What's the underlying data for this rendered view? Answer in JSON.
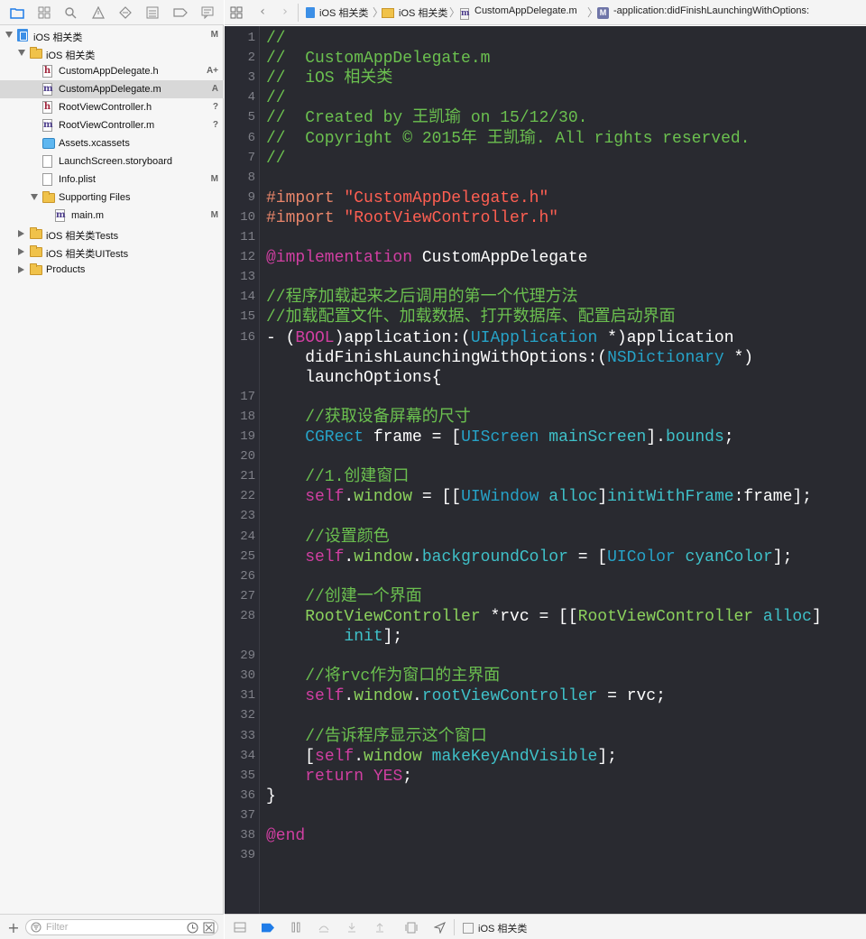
{
  "navigator": {
    "tree": [
      {
        "label": "iOS 相关类",
        "status": "M",
        "indent": 0,
        "disc": "open",
        "icon": "project-icon",
        "selected": false
      },
      {
        "label": "iOS 相关类",
        "status": "",
        "indent": 1,
        "disc": "open",
        "icon": "folder-icon",
        "selected": false
      },
      {
        "label": "CustomAppDelegate.h",
        "status": "A+",
        "indent": 2,
        "disc": "",
        "icon": "header-file-icon",
        "selected": false
      },
      {
        "label": "CustomAppDelegate.m",
        "status": "A",
        "indent": 2,
        "disc": "",
        "icon": "implementation-file-icon",
        "selected": true
      },
      {
        "label": "RootViewController.h",
        "status": "?",
        "indent": 2,
        "disc": "",
        "icon": "header-file-icon",
        "selected": false
      },
      {
        "label": "RootViewController.m",
        "status": "?",
        "indent": 2,
        "disc": "",
        "icon": "implementation-file-icon",
        "selected": false
      },
      {
        "label": "Assets.xcassets",
        "status": "",
        "indent": 2,
        "disc": "",
        "icon": "asset-catalog-icon",
        "selected": false
      },
      {
        "label": "LaunchScreen.storyboard",
        "status": "",
        "indent": 2,
        "disc": "",
        "icon": "storyboard-file-icon",
        "selected": false
      },
      {
        "label": "Info.plist",
        "status": "M",
        "indent": 2,
        "disc": "",
        "icon": "plist-file-icon",
        "selected": false
      },
      {
        "label": "Supporting Files",
        "status": "",
        "indent": 2,
        "disc": "open",
        "icon": "folder-icon",
        "selected": false
      },
      {
        "label": "main.m",
        "status": "M",
        "indent": 3,
        "disc": "",
        "icon": "implementation-file-icon",
        "selected": false
      },
      {
        "label": "iOS 相关类Tests",
        "status": "",
        "indent": 1,
        "disc": "closed",
        "icon": "folder-icon",
        "selected": false
      },
      {
        "label": "iOS 相关类UITests",
        "status": "",
        "indent": 1,
        "disc": "closed",
        "icon": "folder-icon",
        "selected": false
      },
      {
        "label": "Products",
        "status": "",
        "indent": 1,
        "disc": "closed",
        "icon": "folder-icon",
        "selected": false
      }
    ],
    "filter_placeholder": "Filter"
  },
  "jumpbar": {
    "project": "iOS 相关类",
    "group": "iOS 相关类",
    "file": "CustomAppDelegate.m",
    "method_badge": "M",
    "method": "-application:didFinishLaunchingWithOptions:"
  },
  "debugbar": {
    "scheme": "iOS 相关类"
  },
  "editor": {
    "lines": [
      {
        "n": "1",
        "segs": [
          [
            "com",
            "//"
          ]
        ]
      },
      {
        "n": "2",
        "segs": [
          [
            "com",
            "//  CustomAppDelegate.m"
          ]
        ]
      },
      {
        "n": "3",
        "segs": [
          [
            "com",
            "//  iOS 相关类"
          ]
        ]
      },
      {
        "n": "4",
        "segs": [
          [
            "com",
            "//"
          ]
        ]
      },
      {
        "n": "5",
        "segs": [
          [
            "com",
            "//  Created by 王凯瑜 on 15/12/30."
          ]
        ]
      },
      {
        "n": "6",
        "segs": [
          [
            "com",
            "//  Copyright © 2015年 王凯瑜. All rights reserved."
          ]
        ]
      },
      {
        "n": "7",
        "segs": [
          [
            "com",
            "//"
          ]
        ]
      },
      {
        "n": "8",
        "segs": []
      },
      {
        "n": "9",
        "segs": [
          [
            "pre",
            "#import "
          ],
          [
            "str",
            "\"CustomAppDelegate.h\""
          ]
        ]
      },
      {
        "n": "10",
        "segs": [
          [
            "pre",
            "#import "
          ],
          [
            "str",
            "\"RootViewController.h\""
          ]
        ]
      },
      {
        "n": "11",
        "segs": []
      },
      {
        "n": "12",
        "segs": [
          [
            "kw",
            "@implementation"
          ],
          [
            "txt",
            " CustomAppDelegate"
          ]
        ]
      },
      {
        "n": "13",
        "segs": []
      },
      {
        "n": "14",
        "segs": [
          [
            "com",
            "//程序加载起来之后调用的第一个代理方法"
          ]
        ]
      },
      {
        "n": "15",
        "segs": [
          [
            "com",
            "//加载配置文件、加载数据、打开数据库、配置启动界面"
          ]
        ]
      },
      {
        "n": "16",
        "segs": [
          [
            "txt",
            "- ("
          ],
          [
            "kw",
            "BOOL"
          ],
          [
            "txt",
            ")application:("
          ],
          [
            "cls",
            "UIApplication"
          ],
          [
            "txt",
            " *)application"
          ]
        ]
      },
      {
        "n": "",
        "segs": [
          [
            "txt",
            "    didFinishLaunchingWithOptions:("
          ],
          [
            "cls",
            "NSDictionary"
          ],
          [
            "txt",
            " *)"
          ]
        ]
      },
      {
        "n": "",
        "segs": [
          [
            "txt",
            "    launchOptions{"
          ]
        ]
      },
      {
        "n": "17",
        "segs": []
      },
      {
        "n": "18",
        "segs": [
          [
            "com",
            "    //获取设备屏幕的尺寸"
          ]
        ]
      },
      {
        "n": "19",
        "segs": [
          [
            "cls",
            "    CGRect"
          ],
          [
            "txt",
            " frame = ["
          ],
          [
            "cls",
            "UIScreen"
          ],
          [
            "txt",
            " "
          ],
          [
            "mem",
            "mainScreen"
          ],
          [
            "txt",
            "]."
          ],
          [
            "mem",
            "bounds"
          ],
          [
            "txt",
            ";"
          ]
        ]
      },
      {
        "n": "20",
        "segs": []
      },
      {
        "n": "21",
        "segs": [
          [
            "com",
            "    //1.创建窗口"
          ]
        ]
      },
      {
        "n": "22",
        "segs": [
          [
            "kw",
            "    self"
          ],
          [
            "txt",
            "."
          ],
          [
            "pj",
            "window"
          ],
          [
            "txt",
            " = [["
          ],
          [
            "cls",
            "UIWindow"
          ],
          [
            "txt",
            " "
          ],
          [
            "mem",
            "alloc"
          ],
          [
            "txt",
            "]"
          ],
          [
            "mem",
            "initWithFrame"
          ],
          [
            "txt",
            ":frame];"
          ]
        ]
      },
      {
        "n": "23",
        "segs": []
      },
      {
        "n": "24",
        "segs": [
          [
            "com",
            "    //设置颜色"
          ]
        ]
      },
      {
        "n": "25",
        "segs": [
          [
            "kw",
            "    self"
          ],
          [
            "txt",
            "."
          ],
          [
            "pj",
            "window"
          ],
          [
            "txt",
            "."
          ],
          [
            "mem",
            "backgroundColor"
          ],
          [
            "txt",
            " = ["
          ],
          [
            "cls",
            "UIColor"
          ],
          [
            "txt",
            " "
          ],
          [
            "mem",
            "cyanColor"
          ],
          [
            "txt",
            "];"
          ]
        ]
      },
      {
        "n": "26",
        "segs": []
      },
      {
        "n": "27",
        "segs": [
          [
            "com",
            "    //创建一个界面"
          ]
        ]
      },
      {
        "n": "28",
        "segs": [
          [
            "pj",
            "    RootViewController"
          ],
          [
            "txt",
            " *rvc = [["
          ],
          [
            "pj",
            "RootViewController"
          ],
          [
            "txt",
            " "
          ],
          [
            "mem",
            "alloc"
          ],
          [
            "txt",
            "]"
          ]
        ]
      },
      {
        "n": "",
        "segs": [
          [
            "mem",
            "        init"
          ],
          [
            "txt",
            "];"
          ]
        ]
      },
      {
        "n": "29",
        "segs": []
      },
      {
        "n": "30",
        "segs": [
          [
            "com",
            "    //将rvc作为窗口的主界面"
          ]
        ]
      },
      {
        "n": "31",
        "segs": [
          [
            "kw",
            "    self"
          ],
          [
            "txt",
            "."
          ],
          [
            "pj",
            "window"
          ],
          [
            "txt",
            "."
          ],
          [
            "mem",
            "rootViewController"
          ],
          [
            "txt",
            " = rvc;"
          ]
        ]
      },
      {
        "n": "32",
        "segs": []
      },
      {
        "n": "33",
        "segs": [
          [
            "com",
            "    //告诉程序显示这个窗口"
          ]
        ]
      },
      {
        "n": "34",
        "segs": [
          [
            "txt",
            "    ["
          ],
          [
            "kw",
            "self"
          ],
          [
            "txt",
            "."
          ],
          [
            "pj",
            "window"
          ],
          [
            "txt",
            " "
          ],
          [
            "mem",
            "makeKeyAndVisible"
          ],
          [
            "txt",
            "];"
          ]
        ]
      },
      {
        "n": "35",
        "segs": [
          [
            "kw",
            "    return"
          ],
          [
            "txt",
            " "
          ],
          [
            "kw",
            "YES"
          ],
          [
            "txt",
            ";"
          ]
        ]
      },
      {
        "n": "36",
        "segs": [
          [
            "txt",
            "}"
          ]
        ]
      },
      {
        "n": "37",
        "segs": []
      },
      {
        "n": "38",
        "segs": [
          [
            "kw",
            "@end"
          ]
        ]
      },
      {
        "n": "39",
        "segs": []
      }
    ]
  }
}
